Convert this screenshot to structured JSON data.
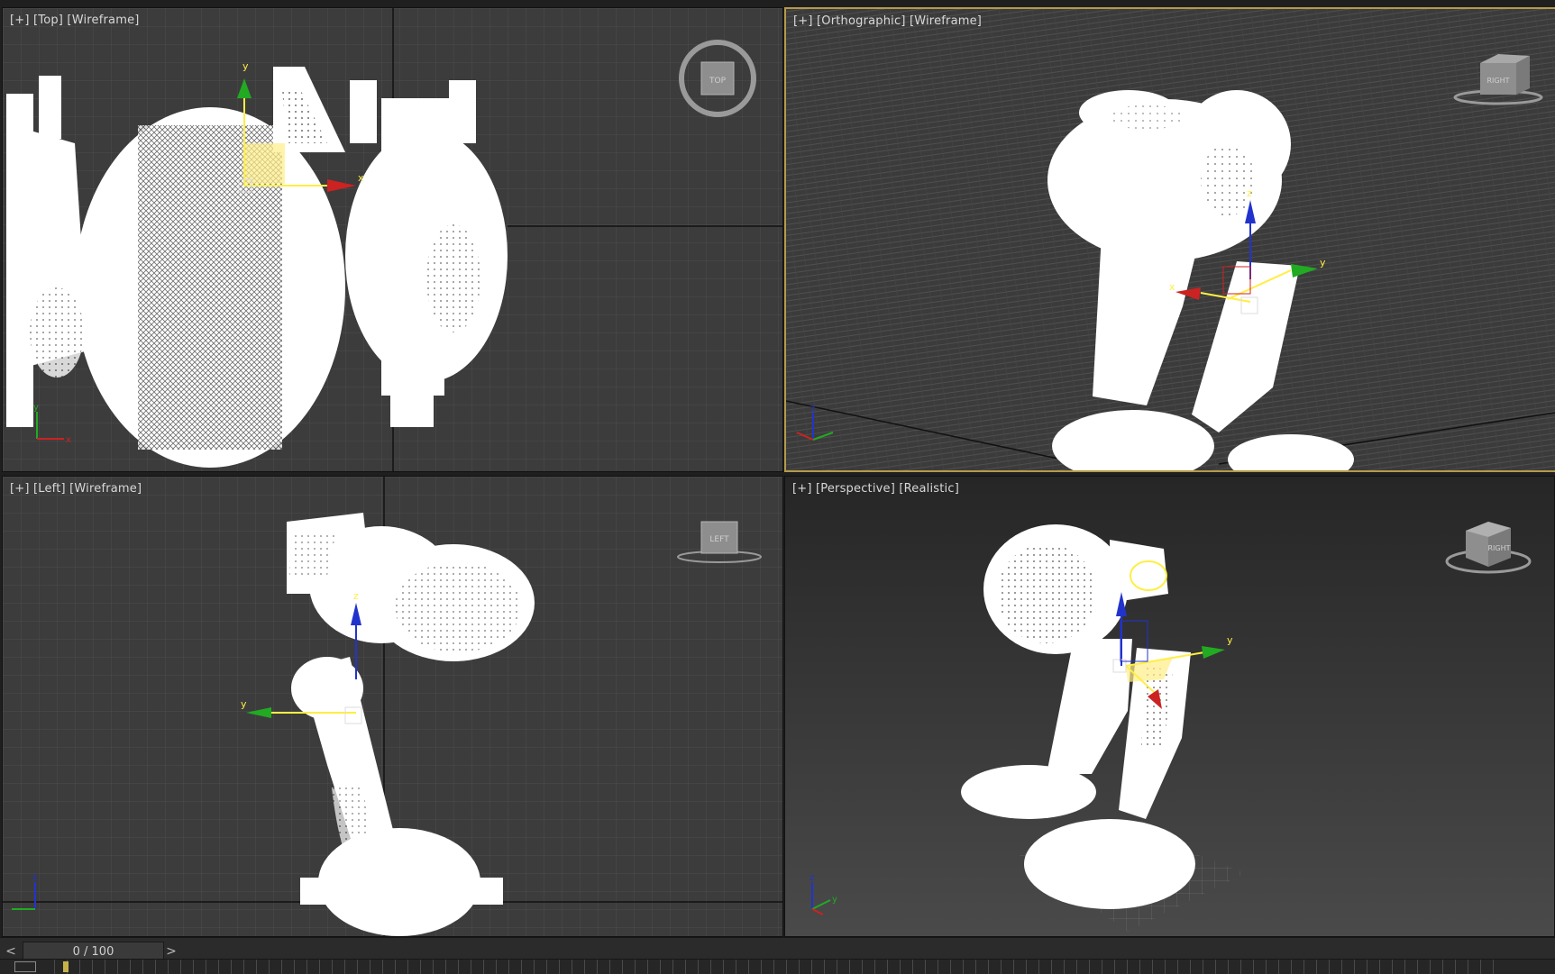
{
  "viewports": [
    {
      "id": "top",
      "plus": "[+]",
      "view": "[Top]",
      "shading": "[Wireframe]",
      "cube_label": "TOP",
      "active": false
    },
    {
      "id": "ortho",
      "plus": "[+]",
      "view": "[Orthographic]",
      "shading": "[Wireframe]",
      "cube_label": "RIGHT",
      "active": true
    },
    {
      "id": "left",
      "plus": "[+]",
      "view": "[Left]",
      "shading": "[Wireframe]",
      "cube_label": "LEFT",
      "active": false
    },
    {
      "id": "persp",
      "plus": "[+]",
      "view": "[Perspective]",
      "shading": "[Realistic]",
      "cube_label": "RIGHT",
      "active": false
    }
  ],
  "axes": {
    "x": "x",
    "y": "y",
    "z": "z"
  },
  "timeline": {
    "prev": "<",
    "next": ">",
    "frame": "0 / 100"
  },
  "colors": {
    "active_border": "#b59a4a",
    "axis_x": "#cc2222",
    "axis_y": "#22aa22",
    "axis_z": "#2233cc",
    "gizmo_yellow": "#ffee44"
  }
}
